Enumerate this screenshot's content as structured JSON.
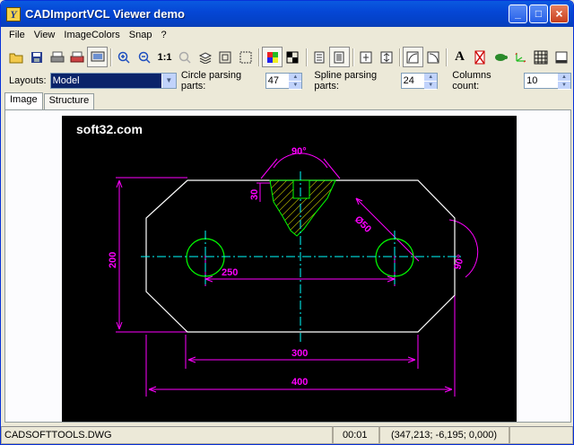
{
  "window": {
    "title": "CADImportVCL Viewer demo"
  },
  "menu": [
    "File",
    "View",
    "ImageColors",
    "Snap",
    "?"
  ],
  "toolbar": {
    "scale_label": "1:1",
    "text_label": "A"
  },
  "options": {
    "layouts_label": "Layouts:",
    "layouts_value": "Model",
    "circle_label": "Circle parsing parts:",
    "circle_value": "47",
    "spline_label": "Spline parsing parts:",
    "spline_value": "24",
    "columns_label": "Columns count:",
    "columns_value": "10"
  },
  "tabs": [
    "Image",
    "Structure"
  ],
  "drawing": {
    "watermark": "soft32.com",
    "dims": {
      "angle_top": "90°",
      "depth": "30",
      "diameter": "Ø50",
      "height": "200",
      "spacing": "250",
      "angle_right": "90°",
      "inner_width": "300",
      "total_width": "400"
    },
    "colors": {
      "outline": "#ffffff",
      "dimension": "#ff00ff",
      "circle": "#00ff00",
      "centerline": "#00ffff",
      "hatch": "#ffff00"
    }
  },
  "status": {
    "file": "CADSOFTTOOLS.DWG",
    "time": "00:01",
    "coords": "(347,213; -6,195; 0,000)"
  }
}
